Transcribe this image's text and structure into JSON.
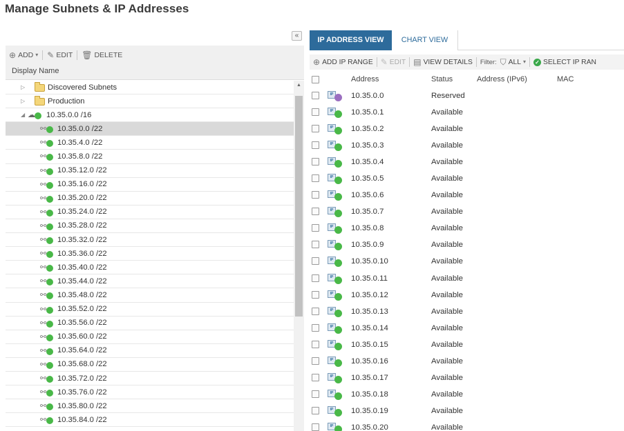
{
  "page_title": "Manage Subnets & IP Addresses",
  "left_toolbar": {
    "add": "ADD",
    "edit": "EDIT",
    "delete": "DELETE"
  },
  "tree_header": "Display Name",
  "tree": {
    "groups": [
      {
        "label": "Discovered Subnets",
        "expanded": false
      },
      {
        "label": "Production",
        "expanded": false
      }
    ],
    "supernet": {
      "label": "10.35.0.0 /16",
      "expanded": true
    },
    "subnets": [
      "10.35.0.0 /22",
      "10.35.4.0 /22",
      "10.35.8.0 /22",
      "10.35.12.0 /22",
      "10.35.16.0 /22",
      "10.35.20.0 /22",
      "10.35.24.0 /22",
      "10.35.28.0 /22",
      "10.35.32.0 /22",
      "10.35.36.0 /22",
      "10.35.40.0 /22",
      "10.35.44.0 /22",
      "10.35.48.0 /22",
      "10.35.52.0 /22",
      "10.35.56.0 /22",
      "10.35.60.0 /22",
      "10.35.64.0 /22",
      "10.35.68.0 /22",
      "10.35.72.0 /22",
      "10.35.76.0 /22",
      "10.35.80.0 /22",
      "10.35.84.0 /22"
    ],
    "selected_index": 0
  },
  "tabs": {
    "ip_view": "IP ADDRESS VIEW",
    "chart_view": "CHART VIEW"
  },
  "right_toolbar": {
    "add_range": "ADD IP RANGE",
    "edit": "EDIT",
    "view_details": "VIEW DETAILS",
    "filter_label": "Filter:",
    "filter_value": "ALL",
    "select_range": "SELECT IP RAN"
  },
  "grid_columns": {
    "address": "Address",
    "status": "Status",
    "ipv6": "Address (IPv6)",
    "mac": "MAC"
  },
  "status_colors": {
    "Reserved": "#9b6fc0",
    "Available": "#49b848"
  },
  "grid_rows": [
    {
      "address": "10.35.0.0",
      "status": "Reserved"
    },
    {
      "address": "10.35.0.1",
      "status": "Available"
    },
    {
      "address": "10.35.0.2",
      "status": "Available"
    },
    {
      "address": "10.35.0.3",
      "status": "Available"
    },
    {
      "address": "10.35.0.4",
      "status": "Available"
    },
    {
      "address": "10.35.0.5",
      "status": "Available"
    },
    {
      "address": "10.35.0.6",
      "status": "Available"
    },
    {
      "address": "10.35.0.7",
      "status": "Available"
    },
    {
      "address": "10.35.0.8",
      "status": "Available"
    },
    {
      "address": "10.35.0.9",
      "status": "Available"
    },
    {
      "address": "10.35.0.10",
      "status": "Available"
    },
    {
      "address": "10.35.0.11",
      "status": "Available"
    },
    {
      "address": "10.35.0.12",
      "status": "Available"
    },
    {
      "address": "10.35.0.13",
      "status": "Available"
    },
    {
      "address": "10.35.0.14",
      "status": "Available"
    },
    {
      "address": "10.35.0.15",
      "status": "Available"
    },
    {
      "address": "10.35.0.16",
      "status": "Available"
    },
    {
      "address": "10.35.0.17",
      "status": "Available"
    },
    {
      "address": "10.35.0.18",
      "status": "Available"
    },
    {
      "address": "10.35.0.19",
      "status": "Available"
    },
    {
      "address": "10.35.0.20",
      "status": "Available"
    }
  ]
}
